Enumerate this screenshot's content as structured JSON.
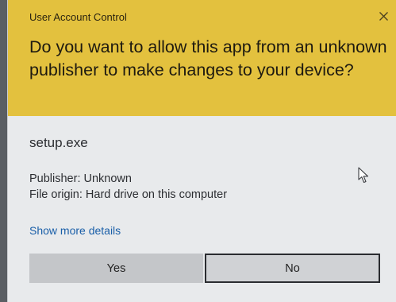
{
  "dialog": {
    "title": "User Account Control",
    "close_symbol": "×",
    "question": "Do you want to allow this app from an unknown publisher to make changes to your device?",
    "app_name": "setup.exe",
    "publisher": "Publisher: Unknown",
    "file_origin": "File origin: Hard drive on this computer",
    "show_more_label": "Show more details",
    "yes_label": "Yes",
    "no_label": "No"
  },
  "icons": {
    "close": "close-icon",
    "cursor": "mouse-pointer-icon"
  },
  "colors": {
    "header": "#e3c13e",
    "body": "#e8eaec",
    "link": "#1a5fa8",
    "yes_button": "#c4c6c9",
    "no_button_border": "#2a2c30"
  }
}
